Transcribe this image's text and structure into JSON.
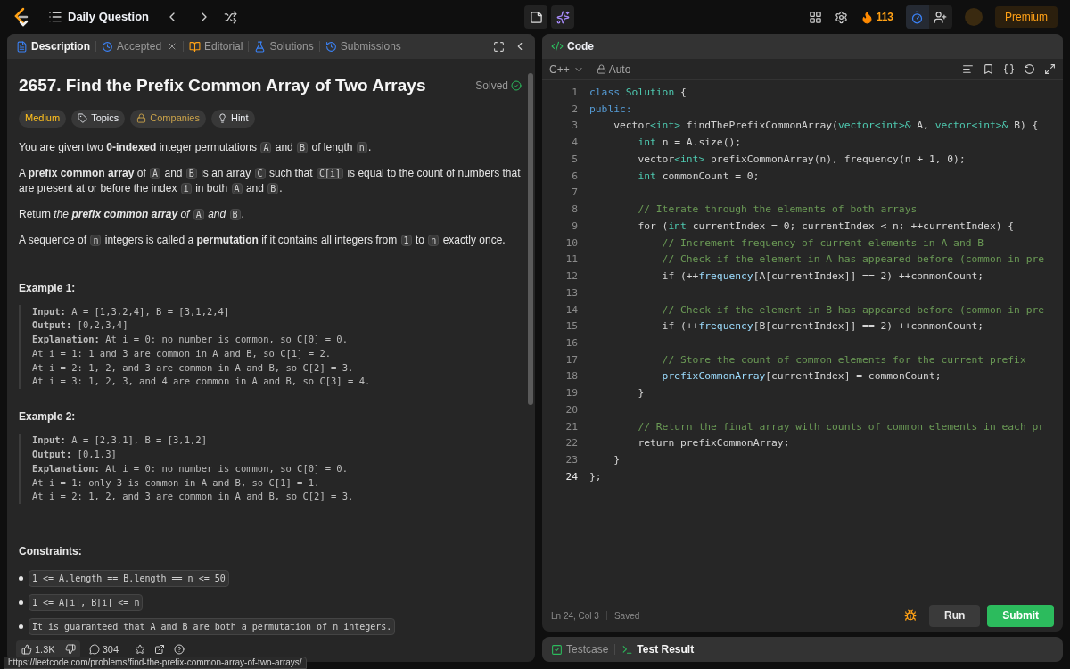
{
  "top_bar": {
    "title": "Daily Question",
    "streak": "113",
    "premium": "Premium"
  },
  "left_panel": {
    "tabs": [
      {
        "kind": "description",
        "label": "Description",
        "selected": true,
        "closable": false
      },
      {
        "kind": "accepted",
        "label": "Accepted",
        "selected": false,
        "closable": true
      },
      {
        "kind": "editorial",
        "label": "Editorial",
        "selected": false,
        "closable": false
      },
      {
        "kind": "solutions",
        "label": "Solutions",
        "selected": false,
        "closable": false
      },
      {
        "kind": "submissions",
        "label": "Submissions",
        "selected": false,
        "closable": false
      }
    ],
    "problem": {
      "title": "2657. Find the Prefix Common Array of Two Arrays",
      "status": "Solved",
      "tags": [
        {
          "kind": "difficulty",
          "label": "Medium"
        },
        {
          "kind": "topics",
          "label": "Topics"
        },
        {
          "kind": "companies",
          "label": "Companies"
        },
        {
          "kind": "hint",
          "label": "Hint"
        }
      ],
      "paragraphs": [
        [
          {
            "kind": "text",
            "text": "You are given two **0-indexed** integer permutations "
          },
          {
            "kind": "code",
            "text": "A"
          },
          {
            "kind": "text",
            "text": " and "
          },
          {
            "kind": "code",
            "text": "B"
          },
          {
            "kind": "text",
            "text": " of length "
          },
          {
            "kind": "code",
            "text": "n"
          },
          {
            "kind": "text",
            "text": "."
          }
        ],
        [
          {
            "kind": "text",
            "text": "A **prefix common array** of "
          },
          {
            "kind": "code",
            "text": "A"
          },
          {
            "kind": "text",
            "text": " and "
          },
          {
            "kind": "code",
            "text": "B"
          },
          {
            "kind": "text",
            "text": " is an array "
          },
          {
            "kind": "code",
            "text": "C"
          },
          {
            "kind": "text",
            "text": " such that "
          },
          {
            "kind": "code",
            "text": "C[i]"
          },
          {
            "kind": "text",
            "text": " is equal to the count of numbers that are present at or before the index "
          },
          {
            "kind": "code",
            "text": "i"
          },
          {
            "kind": "text",
            "text": " in both "
          },
          {
            "kind": "code",
            "text": "A"
          },
          {
            "kind": "text",
            "text": " and "
          },
          {
            "kind": "code",
            "text": "B"
          },
          {
            "kind": "text",
            "text": "."
          }
        ],
        [
          {
            "kind": "text",
            "text": "Return "
          },
          {
            "kind": "italic",
            "text": "the **prefix common array** of "
          },
          {
            "kind": "code",
            "text": "A"
          },
          {
            "kind": "italic",
            "text": " and "
          },
          {
            "kind": "code",
            "text": "B"
          },
          {
            "kind": "text",
            "text": "."
          }
        ],
        [
          {
            "kind": "text",
            "text": "A sequence of "
          },
          {
            "kind": "code",
            "text": "n"
          },
          {
            "kind": "text",
            "text": " integers is called a **permutation** if it contains all integers from "
          },
          {
            "kind": "code",
            "text": "1"
          },
          {
            "kind": "text",
            "text": " to "
          },
          {
            "kind": "code",
            "text": "n"
          },
          {
            "kind": "text",
            "text": " exactly once."
          }
        ]
      ],
      "examples": [
        {
          "heading": "Example 1:",
          "lines": [
            "**Input:** A = [1,3,2,4], B = [3,1,2,4]",
            "**Output:** [0,2,3,4]",
            "**Explanation:** At i = 0: no number is common, so C[0] = 0.",
            "At i = 1: 1 and 3 are common in A and B, so C[1] = 2.",
            "At i = 2: 1, 2, and 3 are common in A and B, so C[2] = 3.",
            "At i = 3: 1, 2, 3, and 4 are common in A and B, so C[3] = 4."
          ]
        },
        {
          "heading": "Example 2:",
          "lines": [
            "**Input:** A = [2,3,1], B = [3,1,2]",
            "**Output:** [0,1,3]",
            "**Explanation:** At i = 0: no number is common, so C[0] = 0.",
            "At i = 1: only 3 is common in A and B, so C[1] = 1.",
            "At i = 2: 1, 2, and 3 are common in A and B, so C[2] = 3."
          ]
        }
      ],
      "constraints_heading": "Constraints:",
      "constraints": [
        "1 <= A.length == B.length == n <= 50",
        "1 <= A[i], B[i] <= n",
        "It is guaranteed that A and B are both a permutation of n integers."
      ]
    },
    "actions": {
      "likes": "1.3K",
      "comments": "304"
    }
  },
  "right_panel": {
    "tab": "Code",
    "language": "C++",
    "mode": "Auto",
    "code_lines": [
      {
        "number": "1",
        "current": false,
        "tokens": [
          {
            "kind": "keyword",
            "text": "class "
          },
          {
            "kind": "type",
            "text": "Solution"
          },
          {
            "kind": "plain",
            "text": " {"
          }
        ]
      },
      {
        "number": "2",
        "current": false,
        "tokens": [
          {
            "kind": "keyword",
            "text": "public:"
          }
        ]
      },
      {
        "number": "3",
        "current": false,
        "tokens": [
          {
            "kind": "plain",
            "text": "    vector"
          },
          {
            "kind": "type",
            "text": "<int>"
          },
          {
            "kind": "plain",
            "text": " findThePrefixCommonArray("
          },
          {
            "kind": "type",
            "text": "vector<int>&"
          },
          {
            "kind": "plain",
            "text": " A, "
          },
          {
            "kind": "type",
            "text": "vector<int>&"
          },
          {
            "kind": "plain",
            "text": " B) {"
          }
        ]
      },
      {
        "number": "4",
        "current": false,
        "tokens": [
          {
            "kind": "type",
            "text": "        int"
          },
          {
            "kind": "plain",
            "text": " n = A.size();"
          }
        ]
      },
      {
        "number": "5",
        "current": false,
        "tokens": [
          {
            "kind": "plain",
            "text": "        vector"
          },
          {
            "kind": "type",
            "text": "<int>"
          },
          {
            "kind": "plain",
            "text": " prefixCommonArray(n), frequency(n + 1, 0);"
          }
        ]
      },
      {
        "number": "6",
        "current": false,
        "tokens": [
          {
            "kind": "type",
            "text": "        int"
          },
          {
            "kind": "plain",
            "text": " commonCount = 0;"
          }
        ]
      },
      {
        "number": "7",
        "current": false
      },
      {
        "number": "8",
        "current": false,
        "tokens": [
          {
            "kind": "comment",
            "text": "        // Iterate through the elements of both arrays"
          }
        ]
      },
      {
        "number": "9",
        "current": false,
        "tokens": [
          {
            "kind": "plain",
            "text": "        for ("
          },
          {
            "kind": "type",
            "text": "int"
          },
          {
            "kind": "plain",
            "text": " currentIndex = 0; currentIndex < n; ++currentIndex) {"
          }
        ]
      },
      {
        "number": "10",
        "current": false,
        "tokens": [
          {
            "kind": "comment",
            "text": "            // Increment frequency of current elements in A and B"
          }
        ]
      },
      {
        "number": "11",
        "current": false,
        "tokens": [
          {
            "kind": "comment",
            "text": "            // Check if the element in A has appeared before (common in pre"
          }
        ]
      },
      {
        "number": "12",
        "current": false,
        "tokens": [
          {
            "kind": "plain",
            "text": "            if (++"
          },
          {
            "kind": "variable",
            "text": "frequency"
          },
          {
            "kind": "plain",
            "text": "[A[currentIndex]] == 2) ++commonCount;"
          }
        ]
      },
      {
        "number": "13",
        "current": false
      },
      {
        "number": "14",
        "current": false,
        "tokens": [
          {
            "kind": "comment",
            "text": "            // Check if the element in B has appeared before (common in pre"
          }
        ]
      },
      {
        "number": "15",
        "current": false,
        "tokens": [
          {
            "kind": "plain",
            "text": "            if (++"
          },
          {
            "kind": "variable",
            "text": "frequency"
          },
          {
            "kind": "plain",
            "text": "[B[currentIndex]] == 2) ++commonCount;"
          }
        ]
      },
      {
        "number": "16",
        "current": false
      },
      {
        "number": "17",
        "current": false,
        "tokens": [
          {
            "kind": "comment",
            "text": "            // Store the count of common elements for the current prefix"
          }
        ]
      },
      {
        "number": "18",
        "current": false,
        "tokens": [
          {
            "kind": "variable",
            "text": "            prefixCommonArray"
          },
          {
            "kind": "plain",
            "text": "[currentIndex] = commonCount;"
          }
        ]
      },
      {
        "number": "19",
        "current": false,
        "tokens": [
          {
            "kind": "plain",
            "text": "        }"
          }
        ]
      },
      {
        "number": "20",
        "current": false
      },
      {
        "number": "21",
        "current": false,
        "tokens": [
          {
            "kind": "comment",
            "text": "        // Return the final array with counts of common elements in each pr"
          }
        ]
      },
      {
        "number": "22",
        "current": false,
        "tokens": [
          {
            "kind": "plain",
            "text": "        return prefixCommonArray;"
          }
        ]
      },
      {
        "number": "23",
        "current": false,
        "tokens": [
          {
            "kind": "plain",
            "text": "    }"
          }
        ]
      },
      {
        "number": "24",
        "current": true,
        "tokens": [
          {
            "kind": "plain",
            "text": "};"
          }
        ]
      }
    ],
    "cursor": "Ln 24, Col 3",
    "save_status": "Saved",
    "run": "Run",
    "submit": "Submit"
  },
  "bottom_panel": {
    "tabs": [
      {
        "kind": "testcase",
        "label": "Testcase",
        "selected": false
      },
      {
        "kind": "result",
        "label": "Test Result",
        "selected": true
      }
    ]
  },
  "status_url": "https://leetcode.com/problems/find-the-prefix-common-array-of-two-arrays/"
}
